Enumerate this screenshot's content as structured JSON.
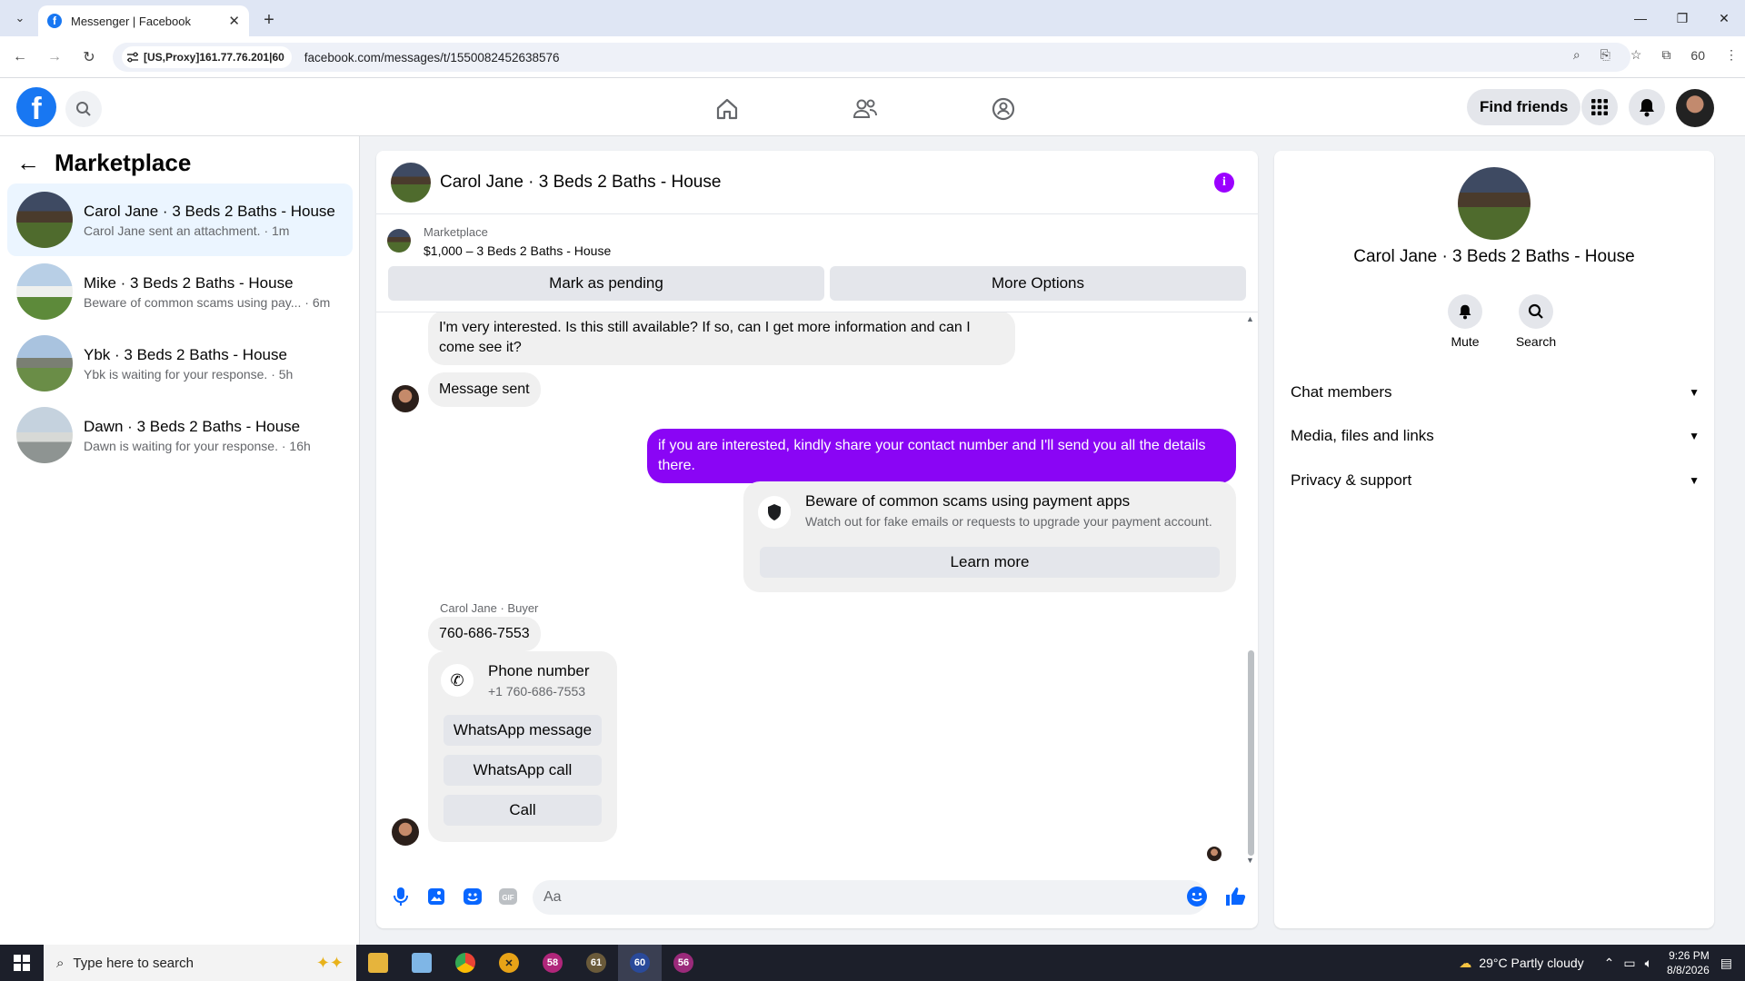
{
  "browser": {
    "tab_title": "Messenger | Facebook",
    "tab_favicon": "f",
    "site_info": "[US,Proxy]161.77.76.201|60",
    "url": "facebook.com/messages/t/1550082452638576",
    "profile_count": "60"
  },
  "fb_header": {
    "find_friends": "Find friends"
  },
  "left": {
    "title": "Marketplace",
    "conversations": [
      {
        "name": "Carol Jane · 3 Beds 2 Baths - House",
        "preview": "Carol Jane sent an attachment. · 1m"
      },
      {
        "name": "Mike · 3 Beds 2 Baths - House",
        "preview": "Beware of common scams using pay... · 6m"
      },
      {
        "name": "Ybk · 3 Beds 2 Baths - House",
        "preview": "Ybk is waiting for your response. · 5h"
      },
      {
        "name": "Dawn · 3 Beds 2 Baths - House",
        "preview": "Dawn is waiting for your response. · 16h"
      }
    ]
  },
  "chat": {
    "title": "Carol Jane · 3 Beds 2 Baths - House",
    "listing_source": "Marketplace",
    "listing_price": "$1,000 – 3 Beds 2 Baths - House",
    "mark_pending": "Mark as pending",
    "more_options": "More Options",
    "messages": {
      "m1": "I'm very interested. Is this still available? If so, can I get more information and can I come see it?",
      "m2": "Message sent",
      "m3": "if you are interested, kindly share your contact number and I'll send you all the details there.",
      "scam_title": "Beware of common scams using payment apps",
      "scam_sub": "Watch out for fake emails or requests to upgrade your payment account.",
      "learn_more": "Learn more",
      "sender_label": "Carol Jane · Buyer",
      "m4": "760-686-7553",
      "phone_title": "Phone number",
      "phone_value": "+1 760-686-7553",
      "whatsapp_message": "WhatsApp message",
      "whatsapp_call": "WhatsApp call",
      "call": "Call"
    },
    "composer_placeholder": "Aa",
    "accent_color": "#8a05f5"
  },
  "right": {
    "name": "Carol Jane · 3 Beds 2 Baths - House",
    "mute": "Mute",
    "search": "Search",
    "sections": [
      "Chat members",
      "Media, files and links",
      "Privacy & support"
    ]
  },
  "taskbar": {
    "search_placeholder": "Type here to search",
    "apps": [
      "58",
      "61",
      "60",
      "56"
    ],
    "weather": "29°C  Partly cloudy",
    "time": "9:26 PM",
    "date": "8/8/2026"
  }
}
